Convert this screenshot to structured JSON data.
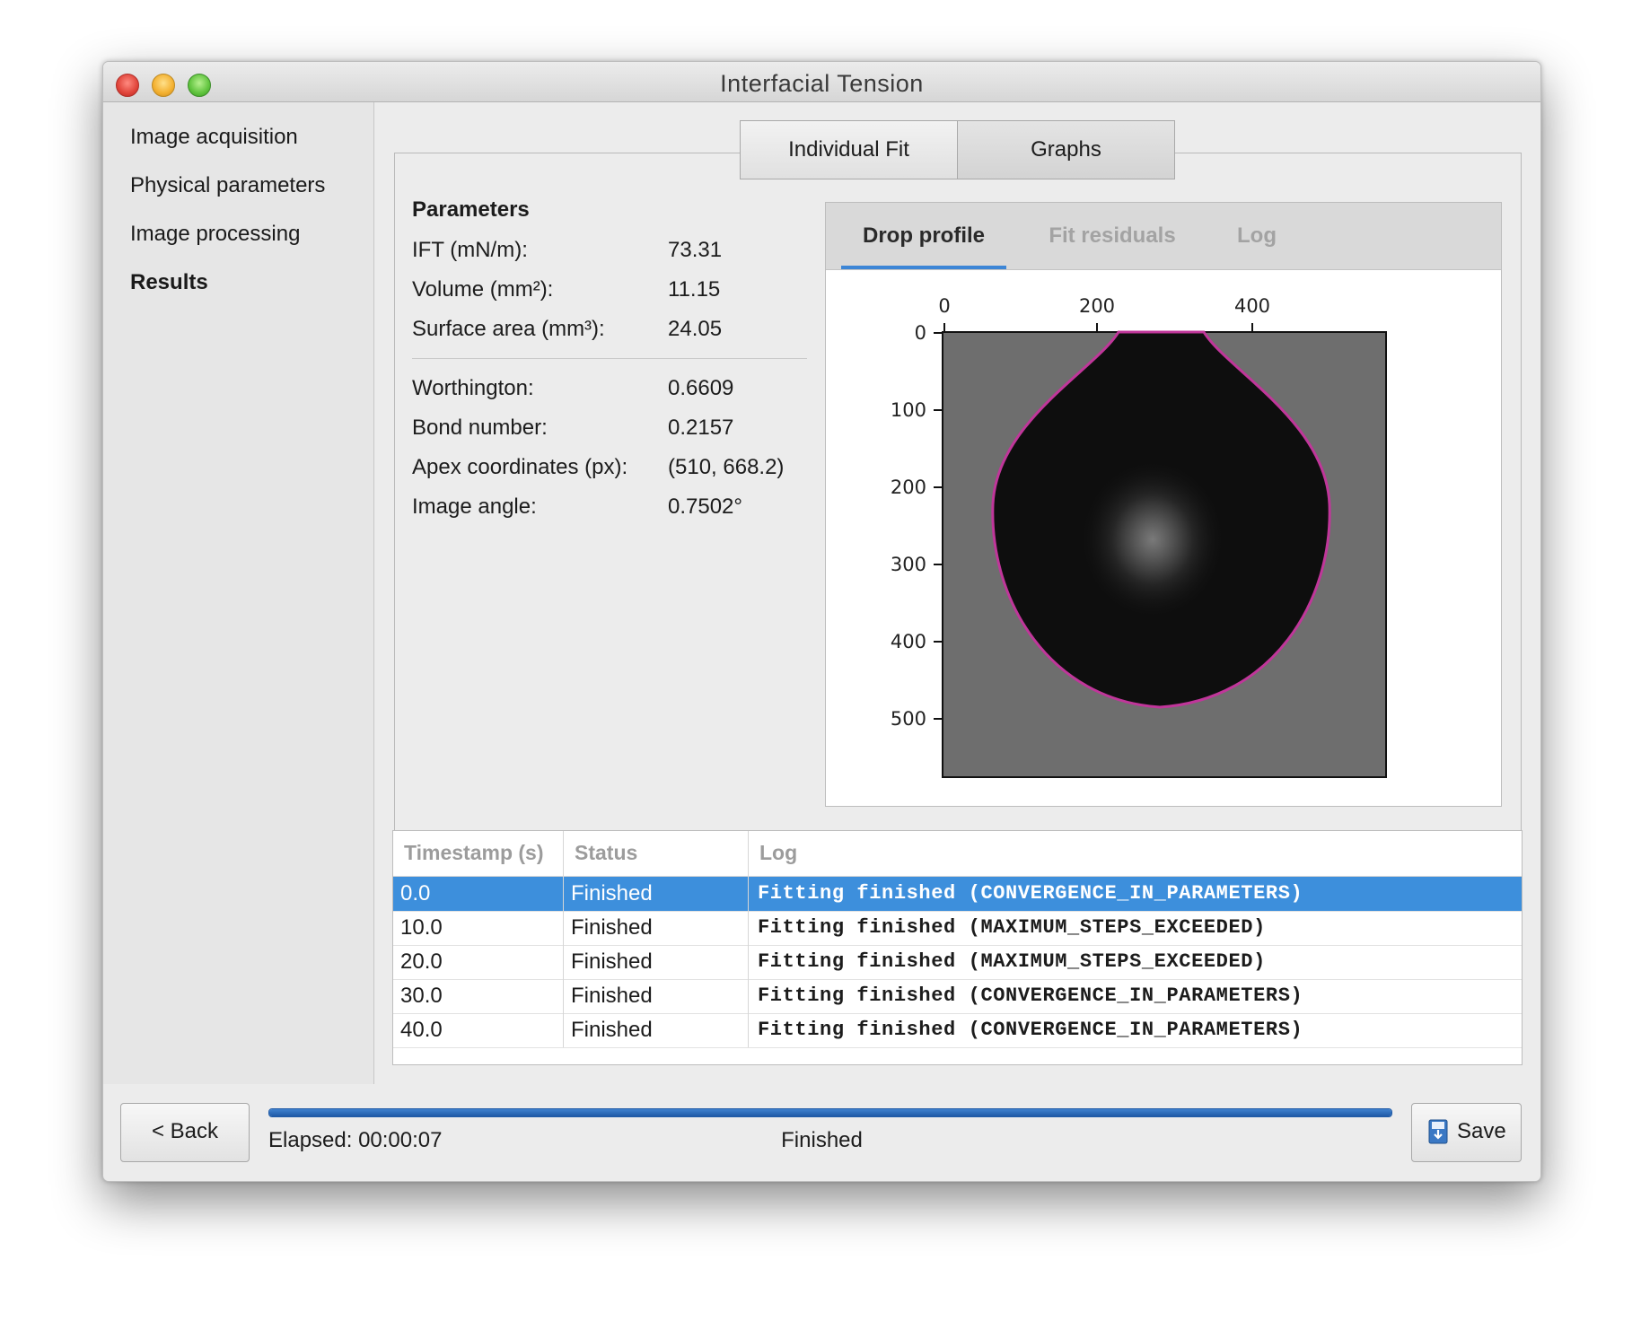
{
  "window": {
    "title": "Interfacial Tension"
  },
  "sidebar": {
    "items": [
      {
        "label": "Image acquisition"
      },
      {
        "label": "Physical parameters"
      },
      {
        "label": "Image processing"
      },
      {
        "label": "Results"
      }
    ],
    "active": "Results"
  },
  "top_tabs": [
    {
      "label": "Individual Fit"
    },
    {
      "label": "Graphs"
    }
  ],
  "parameters": {
    "title": "Parameters",
    "rows": [
      {
        "label": "IFT (mN/m):",
        "value": "73.31"
      },
      {
        "label": "Volume (mm²):",
        "value": "11.15"
      },
      {
        "label": "Surface area (mm³):",
        "value": "24.05"
      },
      {
        "label": "Worthington:",
        "value": "0.6609"
      },
      {
        "label": "Bond number:",
        "value": "0.2157"
      },
      {
        "label": "Apex coordinates (px):",
        "value": "(510, 668.2)"
      },
      {
        "label": "Image angle:",
        "value": "0.7502°"
      }
    ]
  },
  "plot_tabs": [
    {
      "label": "Drop profile"
    },
    {
      "label": "Fit residuals"
    },
    {
      "label": "Log"
    }
  ],
  "plot_tabs_active": "Drop profile",
  "drop_plot": {
    "x_ticks": [
      "0",
      "200",
      "400"
    ],
    "y_ticks": [
      "0",
      "100",
      "200",
      "300",
      "400",
      "500"
    ],
    "profile_color": "#c0369a",
    "background_color": "#6e6e6e",
    "drop_color": "#0e0e0e"
  },
  "table": {
    "columns": [
      "Timestamp (s)",
      "Status",
      "Log"
    ],
    "rows": [
      {
        "timestamp": "0.0",
        "status": "Finished",
        "log": "Fitting finished (CONVERGENCE_IN_PARAMETERS)",
        "selected": true
      },
      {
        "timestamp": "10.0",
        "status": "Finished",
        "log": "Fitting finished (MAXIMUM_STEPS_EXCEEDED)",
        "selected": false
      },
      {
        "timestamp": "20.0",
        "status": "Finished",
        "log": "Fitting finished (MAXIMUM_STEPS_EXCEEDED)",
        "selected": false
      },
      {
        "timestamp": "30.0",
        "status": "Finished",
        "log": "Fitting finished (CONVERGENCE_IN_PARAMETERS)",
        "selected": false
      },
      {
        "timestamp": "40.0",
        "status": "Finished",
        "log": "Fitting finished (CONVERGENCE_IN_PARAMETERS)",
        "selected": false
      }
    ]
  },
  "footer": {
    "back_label": "< Back",
    "save_label": "Save",
    "save_icon": "download-icon",
    "elapsed": "Elapsed: 00:00:07",
    "status": "Finished",
    "progress": 1.0
  }
}
